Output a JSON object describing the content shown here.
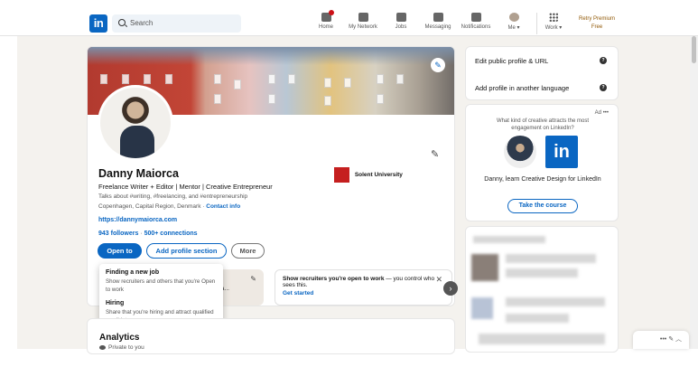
{
  "topbar": {
    "logo": "in",
    "search_placeholder": "Search",
    "nav": [
      {
        "label": "Home",
        "icon": "home-icon"
      },
      {
        "label": "My Network",
        "icon": "network-icon"
      },
      {
        "label": "Jobs",
        "icon": "briefcase-icon"
      },
      {
        "label": "Messaging",
        "icon": "message-icon"
      },
      {
        "label": "Notifications",
        "icon": "bell-icon"
      },
      {
        "label": "Me ▾",
        "icon": "avatar-icon"
      },
      {
        "label": "Work ▾",
        "icon": "grid-icon"
      }
    ],
    "premium_line1": "Retry Premium",
    "premium_line2": "Free"
  },
  "profile": {
    "name": "Danny Maiorca",
    "headline": "Freelance Writer + Editor | Mentor | Creative Entrepreneur",
    "about": "Talks about #writing, #freelancing, and #entrepreneurship",
    "location": "Copenhagen, Capital Region, Denmark",
    "contact_sep": " · ",
    "contact_info": "Contact info",
    "website": "https://dannymaiorca.com",
    "followers": "943 followers",
    "stats_sep": " · ",
    "connections": "500+ connections",
    "school": "Solent University",
    "buttons": {
      "open_to": "Open to",
      "add_section": "Add profile section",
      "more": "More"
    }
  },
  "dropdown": {
    "items": [
      {
        "title": "Finding a new job",
        "desc": "Show recruiters and others that you're Open to work"
      },
      {
        "title": "Hiring",
        "desc": "Share that you're hiring and attract qualified candidates"
      }
    ]
  },
  "cards": {
    "grey_snippet": "dia Ma...",
    "open_to_work_strong": "Show recruiters you're open to work",
    "open_to_work_rest": " — you control who sees this.",
    "get_started": "Get started"
  },
  "analytics": {
    "title": "Analytics",
    "subtitle": "Private to you"
  },
  "sidebar": {
    "edit_public": "Edit public profile & URL",
    "add_language": "Add profile in another language"
  },
  "ad": {
    "label": "Ad",
    "more": "•••",
    "headline": "What kind of creative attracts the most engagement on LinkedIn?",
    "logo": "in",
    "text": "Danny, learn Creative Design for LinkedIn",
    "cta": "Take the course"
  },
  "messaging_bar": "•••   ✎   ︿",
  "colors": {
    "brand": "#0a66c2",
    "background": "#f4f2ee",
    "premium": "#915907",
    "badge": "#cc1016"
  }
}
